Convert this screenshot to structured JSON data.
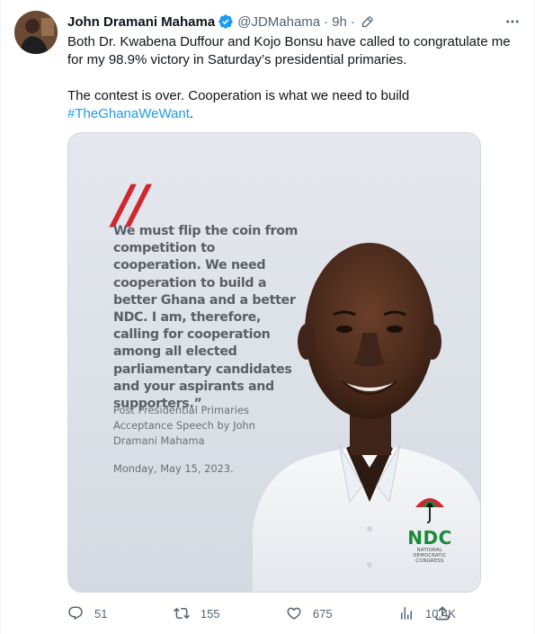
{
  "author": {
    "name": "John Dramani Mahama",
    "handle": "@JDMahama",
    "separator": "·",
    "time": "9h",
    "separator2": "·"
  },
  "tweet": {
    "line1": "Both Dr. Kwabena Duffour and Kojo Bonsu have called to congratulate me for my 98.9% victory in Saturday’s presidential primaries.",
    "line2_prefix": "The contest is over. Cooperation is what we need to build",
    "hashtag": "#TheGhanaWeWant",
    "line2_suffix": "."
  },
  "media": {
    "quote_mark": "//",
    "quote": "We must flip the coin from competition to cooperation. We need cooperation to build a better Ghana and a better NDC. I am, therefore, calling for cooperation among all elected parliamentary candidates and your aspirants and supporters.”",
    "credit": "Post Presidential Primaries Acceptance Speech by John Dramani Mahama",
    "date": "Monday, May 15, 2023.",
    "logo": {
      "text": "NDC",
      "sub1": "NATIONAL",
      "sub2": "DEMOCRATIC",
      "sub3": "CONGRESS"
    }
  },
  "metrics": {
    "replies": "51",
    "retweets": "155",
    "likes": "675",
    "views": "10.4K"
  },
  "icons": {
    "verified": "verified-badge-icon",
    "edit": "edit-pencil-icon",
    "more": "more-dots-icon",
    "reply": "reply-icon",
    "retweet": "retweet-icon",
    "like": "heart-icon",
    "views": "views-chart-icon",
    "share": "share-icon"
  },
  "colors": {
    "accent": "#1d9bf0",
    "secondary_text": "#536471",
    "quote_red": "#d1262f",
    "ndc_green": "#1a8a3a"
  }
}
